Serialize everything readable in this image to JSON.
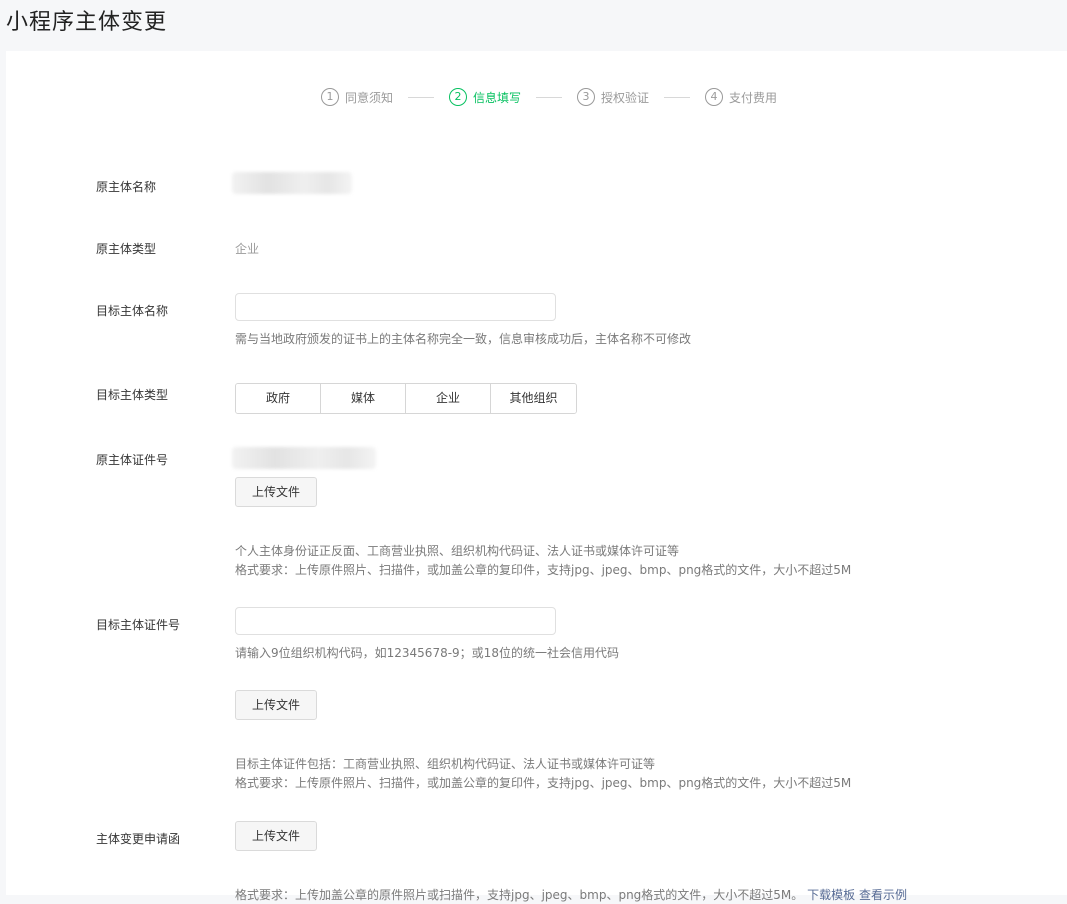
{
  "page": {
    "title": "小程序主体变更"
  },
  "steps": [
    {
      "num": "1",
      "label": "同意须知"
    },
    {
      "num": "2",
      "label": "信息填写"
    },
    {
      "num": "3",
      "label": "授权验证"
    },
    {
      "num": "4",
      "label": "支付费用"
    }
  ],
  "active_step": 2,
  "colors": {
    "accent": "#07c160",
    "link": "#576b95"
  },
  "form": {
    "orig_name": {
      "label": "原主体名称"
    },
    "orig_type": {
      "label": "原主体类型",
      "value": "企业"
    },
    "target_name": {
      "label": "目标主体名称",
      "value": "",
      "hint": "需与当地政府颁发的证书上的主体名称完全一致，信息审核成功后，主体名称不可修改"
    },
    "target_type": {
      "label": "目标主体类型",
      "options": [
        "政府",
        "媒体",
        "企业",
        "其他组织"
      ]
    },
    "orig_cert": {
      "label": "原主体证件号",
      "upload_label": "上传文件",
      "hint1": "个人主体身份证正反面、工商营业执照、组织机构代码证、法人证书或媒体许可证等",
      "hint2": "格式要求：上传原件照片、扫描件，或加盖公章的复印件，支持jpg、jpeg、bmp、png格式的文件，大小不超过5M"
    },
    "target_cert": {
      "label": "目标主体证件号",
      "value": "",
      "hint": "请输入9位组织机构代码，如12345678-9；或18位的统一社会信用代码",
      "upload_label": "上传文件",
      "hint1": "目标主体证件包括：工商营业执照、组织机构代码证、法人证书或媒体许可证等",
      "hint2": "格式要求：上传原件照片、扫描件，或加盖公章的复印件，支持jpg、jpeg、bmp、png格式的文件，大小不超过5M"
    },
    "letter": {
      "label": "主体变更申请函",
      "upload_label": "上传文件",
      "hint": "格式要求：上传加盖公章的原件照片或扫描件，支持jpg、jpeg、bmp、png格式的文件，大小不超过5M。",
      "link1": "下载模板",
      "link2": "查看示例"
    }
  }
}
